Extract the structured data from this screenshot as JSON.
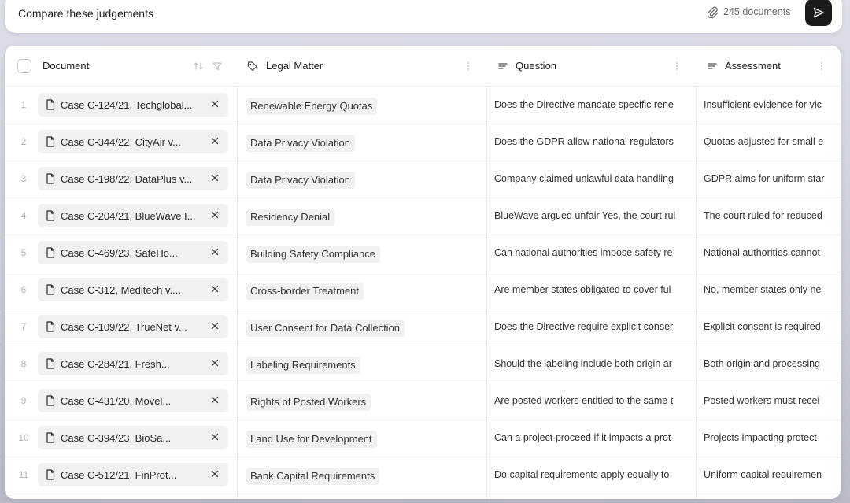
{
  "prompt": {
    "text": "Compare these judgements",
    "attachments_label": "245 documents",
    "attach_icon": "paperclip-icon",
    "send_icon": "send-arrow-icon"
  },
  "columns": {
    "document": "Document",
    "legal_matter": "Legal Matter",
    "question": "Question",
    "assessment": "Assessment"
  },
  "rows": [
    {
      "n": "1",
      "doc": "Case C-124/21, Techglobal...",
      "matter": "Renewable Energy Quotas",
      "question": "Does the Directive mandate specific rene",
      "assessment": "Insufficient evidence for vic"
    },
    {
      "n": "2",
      "doc": "Case C-344/22, CityAir v...",
      "matter": "Data Privacy Violation",
      "question": "Does the GDPR allow national regulators",
      "assessment": "Quotas adjusted for small e"
    },
    {
      "n": "3",
      "doc": "Case C-198/22, DataPlus v...",
      "matter": "Data Privacy Violation",
      "question": "Company claimed unlawful data handling",
      "assessment": "GDPR aims for uniform star"
    },
    {
      "n": "4",
      "doc": "Case C-204/21, BlueWave I...",
      "matter": "Residency Denial",
      "question": "BlueWave argued unfair Yes, the court rul",
      "assessment": "The court ruled for reduced"
    },
    {
      "n": "5",
      "doc": "Case C-469/23, SafeHo...",
      "matter": "Building Safety Compliance",
      "question": "Can national authorities impose safety re",
      "assessment": "National authorities cannot"
    },
    {
      "n": "6",
      "doc": "Case C-312, Meditech v....",
      "matter": "Cross-border Treatment",
      "question": "Are member states obligated to cover ful",
      "assessment": "No, member states only ne"
    },
    {
      "n": "7",
      "doc": "Case C-109/22, TrueNet v...",
      "matter": "User Consent for Data Collection",
      "question": "Does the Directive require explicit conser",
      "assessment": "Explicit consent is required"
    },
    {
      "n": "8",
      "doc": "Case C-284/21, Fresh...",
      "matter": "Labeling Requirements",
      "question": "Should the labeling include both origin ar",
      "assessment": "Both origin and processing"
    },
    {
      "n": "9",
      "doc": "Case C-431/20, Movel...",
      "matter": "Rights of Posted Workers",
      "question": "Are posted workers entitled to the same t",
      "assessment": "Posted workers must recei"
    },
    {
      "n": "10",
      "doc": "Case C-394/23, BioSa...",
      "matter": "Land Use for Development",
      "question": "Can a project proceed if it impacts a prot",
      "assessment": "Projects impacting protect"
    },
    {
      "n": "11",
      "doc": "Case C-512/21, FinProt...",
      "matter": "Bank Capital Requirements",
      "question": "Do capital requirements apply equally to",
      "assessment": "Uniform capital requiremen"
    }
  ]
}
